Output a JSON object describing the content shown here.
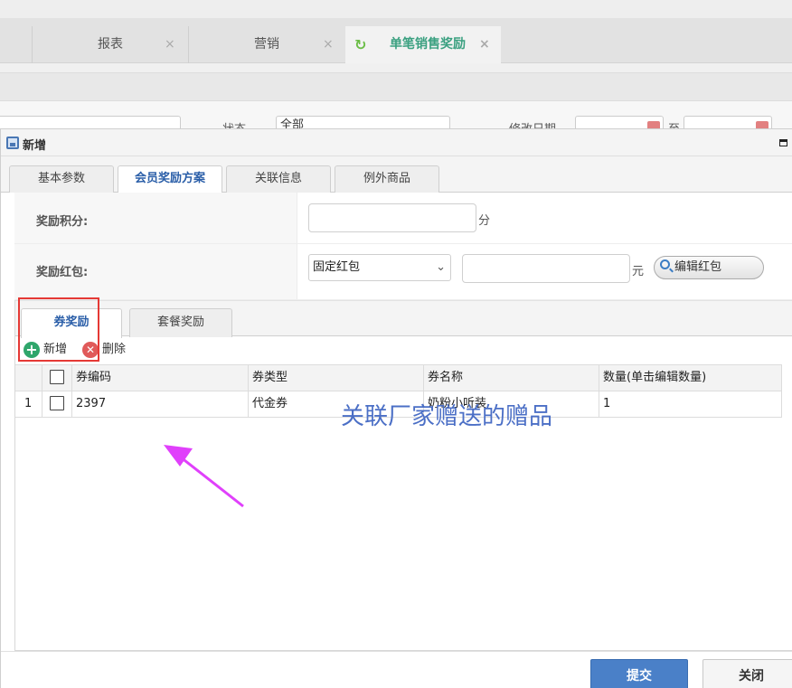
{
  "top_tabs": [
    {
      "label": "报表",
      "close": "×"
    },
    {
      "label": "营销",
      "close": "×"
    },
    {
      "label": "单笔销售奖励",
      "close": "×",
      "active": true
    }
  ],
  "filter": {
    "status_label": "状态",
    "status_value": "全部",
    "date_label": "修改日期",
    "to_label": "至"
  },
  "dialog": {
    "title": "新增",
    "tabs": [
      "基本参数",
      "会员奖励方案",
      "关联信息",
      "例外商品"
    ],
    "active_tab": "会员奖励方案",
    "form": {
      "points_label": "奖励积分:",
      "points_value": "",
      "points_unit": "分",
      "redpacket_label": "奖励红包:",
      "redpacket_type": "固定红包",
      "redpacket_amount": "",
      "redpacket_unit": "元",
      "edit_redpacket_label": "编辑红包"
    },
    "sub_tabs": [
      "券奖励",
      "套餐奖励"
    ],
    "toolbar": {
      "add_label": "新增",
      "delete_label": "删除"
    },
    "grid": {
      "columns": [
        "券编码",
        "券类型",
        "券名称",
        "数量(单击编辑数量)"
      ],
      "rows": [
        {
          "index": "1",
          "code": "2397",
          "type": "代金券",
          "name": "奶粉小听装",
          "qty": "1"
        }
      ]
    },
    "annotation": "关联厂家赠送的赠品",
    "submit_label": "提交",
    "close_label": "关闭"
  },
  "colors": {
    "accent": "#4a80c8",
    "active_tab_text": "#2a5ea8",
    "annotation": "#4b6fc6",
    "arrow": "#e040fb",
    "highlight": "#e53935"
  }
}
